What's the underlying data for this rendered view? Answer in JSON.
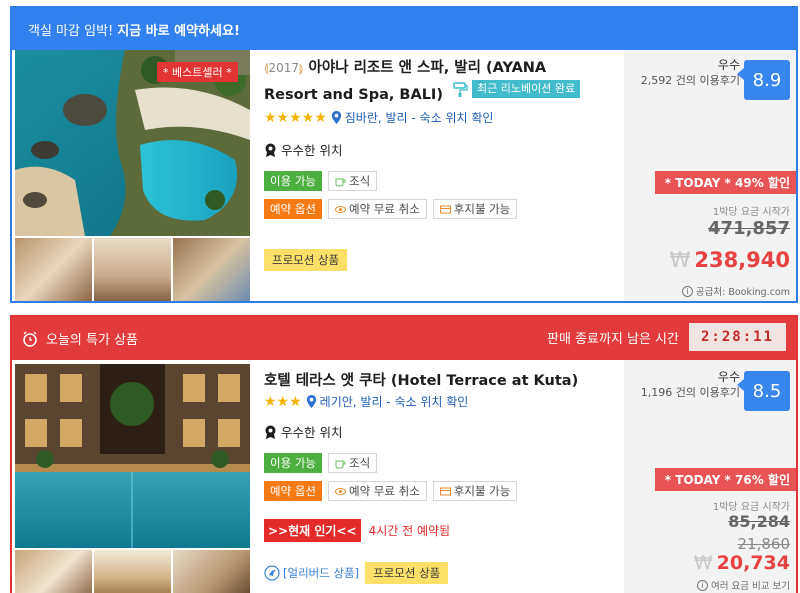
{
  "card1": {
    "banner": {
      "text1": "객실 마감 임박!",
      "text2": "지금 바로 예약하세요!"
    },
    "bestseller": "* 베스트셀러 *",
    "year": "2017",
    "title_line1": "아야나 리조트 앤 스파, 발리 (AYANA",
    "title_line2": "Resort and Spa, BALI)",
    "renovated": "최근 리노베이션 완료",
    "stars": "★★★★★",
    "location": "짐바란, 발리 - 숙소 위치 확인",
    "feature": "우수한 위치",
    "tags": {
      "available": "이용 가능",
      "breakfast": "조식",
      "options": "예약 옵션",
      "free_cancel": "예약 무료 취소",
      "pay_later": "후지불 가능"
    },
    "promo": "프로모션 상품",
    "rating": {
      "label": "우수",
      "count": "2,592 건의 이용후기",
      "score": "8.9"
    },
    "discount": "* TODAY * 49% 할인",
    "per_night": "1박당 요금 시작가",
    "old_price": "471,857",
    "currency": "₩",
    "new_price": "238,940",
    "source": "공급처: Booking.com"
  },
  "card2": {
    "banner": {
      "text": "오늘의 특가 상품",
      "remain": "판매 종료까지 남은 시간",
      "timer": "2:28:11"
    },
    "title": "호텔 테라스 앳 쿠타 (Hotel Terrace at Kuta)",
    "stars": "★★★",
    "location": "레기안, 발리 - 숙소 위치 확인",
    "feature": "우수한 위치",
    "tags": {
      "available": "이용 가능",
      "breakfast": "조식",
      "options": "예약 옵션",
      "free_cancel": "예약 무료 취소",
      "pay_later": "후지불 가능"
    },
    "popular": ">>현재 인기<<",
    "popular_text": "4시간 전 예약됨",
    "early_bird": "[얼리버드 상품]",
    "promo": "프로모션 상품",
    "rating": {
      "label": "우수",
      "count": "1,196 건의 이용후기",
      "score": "8.5"
    },
    "discount": "* TODAY * 76% 할인",
    "per_night": "1박당 요금 시작가",
    "old_price": "85,284",
    "old_price2": "21,860",
    "currency": "₩",
    "new_price": "20,734",
    "compare": "여러 요금 비교 보기"
  }
}
